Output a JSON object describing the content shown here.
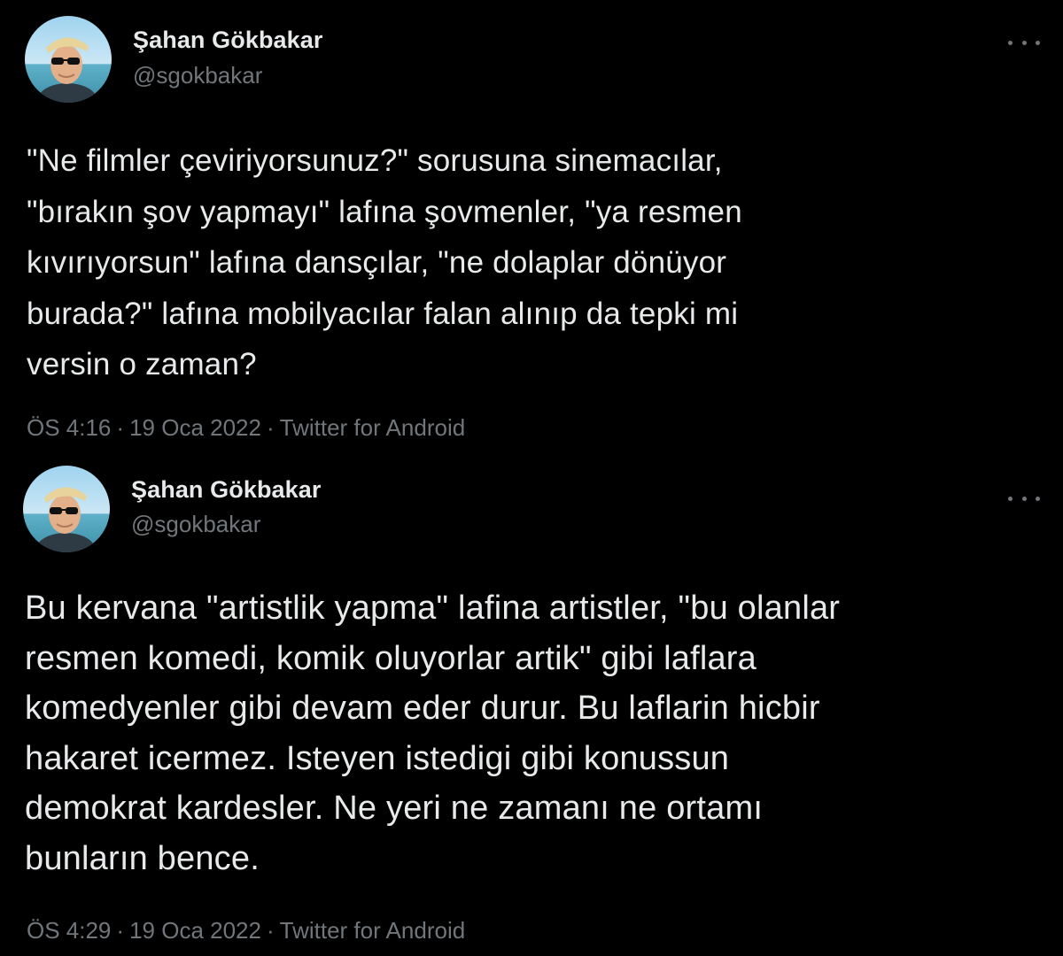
{
  "tweets": [
    {
      "author": {
        "display_name": "Şahan Gökbakar",
        "handle": "@sgokbakar"
      },
      "text": "\"Ne filmler çeviriyorsunuz?\" sorusuna sinemacılar,\n\"bırakın şov yapmayı\" lafına şovmenler, \"ya resmen\nkıvırıyorsun\" lafına dansçılar, \"ne dolaplar dönüyor\nburada?\" lafına mobilyacılar falan alınıp da tepki mi\nversin o zaman?",
      "time": "ÖS 4:16",
      "date": "19 Oca 2022",
      "source": "Twitter for Android",
      "separator": "·"
    },
    {
      "author": {
        "display_name": "Şahan Gökbakar",
        "handle": "@sgokbakar"
      },
      "text": "Bu kervana \"artistlik yapma\" lafina artistler, \"bu olanlar\nresmen komedi, komik oluyorlar artik\" gibi laflara\nkomedyenler gibi devam eder durur. Bu laflarin hicbir\nhakaret icermez. Isteyen istedigi gibi konussun\ndemokrat kardesler. Ne yeri ne zamanı ne ortamı\nbunların bence.",
      "time": "ÖS 4:29",
      "date": "19 Oca 2022",
      "source": "Twitter for Android",
      "separator": "·"
    }
  ],
  "icons": {
    "avatar": "avatar-photo",
    "more": "more-options-icon"
  },
  "colors": {
    "background": "#000000",
    "primary_text": "#e7e9ea",
    "secondary_text": "#71767b"
  }
}
